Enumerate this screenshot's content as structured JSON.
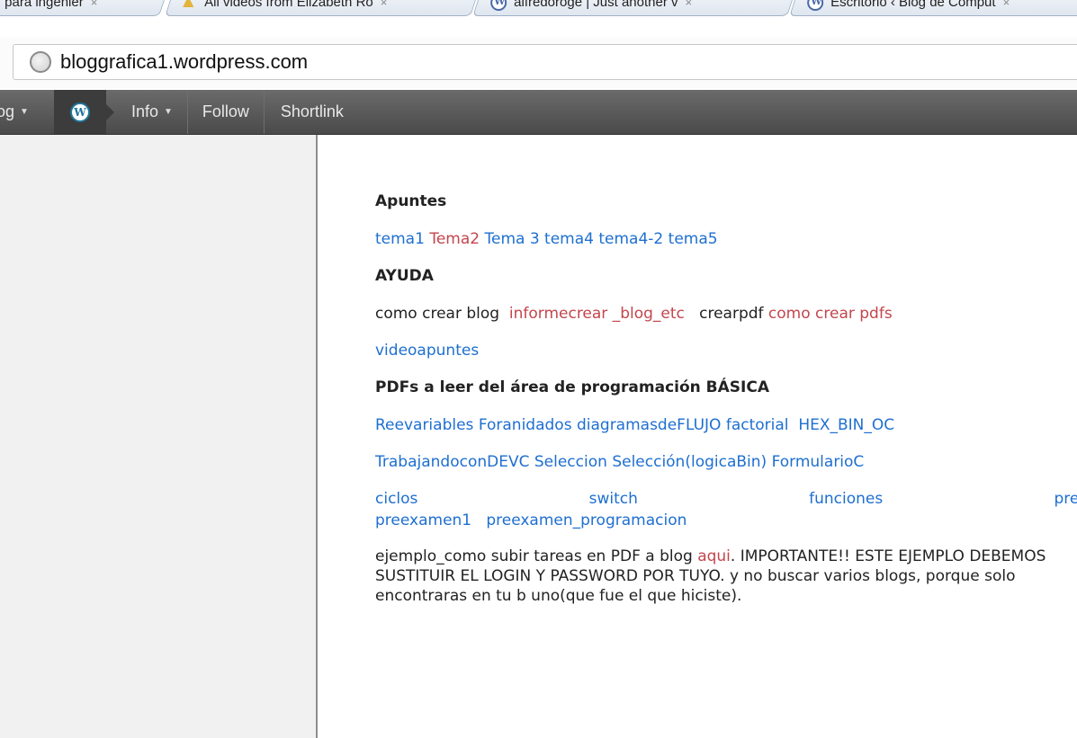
{
  "browser": {
    "tabs": [
      {
        "label": "para ingenier",
        "close": "×"
      },
      {
        "label": "All videos from Elizabeth Ro",
        "close": "×"
      },
      {
        "label": "alfredoroge | Just another v",
        "close": "×"
      },
      {
        "label": "Escritorio ‹ Blog de Comput",
        "close": "×"
      }
    ],
    "url": "bloggrafica1.wordpress.com"
  },
  "adminbar": {
    "blog_label": "og",
    "info_label": "Info",
    "follow_label": "Follow",
    "shortlink_label": "Shortlink",
    "caret": "▼",
    "wp_logo_letter": "W"
  },
  "post": {
    "apuntes_heading": "Apuntes",
    "apuntes_links": [
      "tema1",
      "Tema2",
      "Tema 3",
      "tema4",
      "tema4-2",
      "tema5"
    ],
    "ayuda_heading": "AYUDA",
    "ayuda_text1": "como crear blog",
    "ayuda_link1": "informecrear _blog_etc",
    "ayuda_text2": "crearpdf",
    "ayuda_link2": "como crear pdfs",
    "videoapuntes": "videoapuntes",
    "pdfs_heading": "PDFs a leer del área de programación BÁSICA",
    "row1_links": [
      "Reevariables",
      "Foranidados",
      "diagramasdeFLUJO",
      "factorial",
      "HEX_BIN_OC"
    ],
    "row2_links": [
      "TrabajandoconDEVC",
      "Seleccion",
      "Selección(logicaBin)",
      "FormularioC"
    ],
    "row3_links": [
      "ciclos",
      "switch",
      "funciones",
      "preexame"
    ],
    "row4_links": [
      "preexamen1",
      "preexamen_programacion"
    ],
    "ejemplo_text1": "ejemplo_como subir tareas en PDF a blog",
    "ejemplo_link": "aqui",
    "ejemplo_text2": ".    IMPORTANTE!! ESTE EJEMPLO DEBEMOS SUSTITUIR EL LOGIN Y PASSWORD POR TUYO. y no buscar varios blogs, porque solo encontraras en tu b uno(que fue el que hiciste)."
  }
}
